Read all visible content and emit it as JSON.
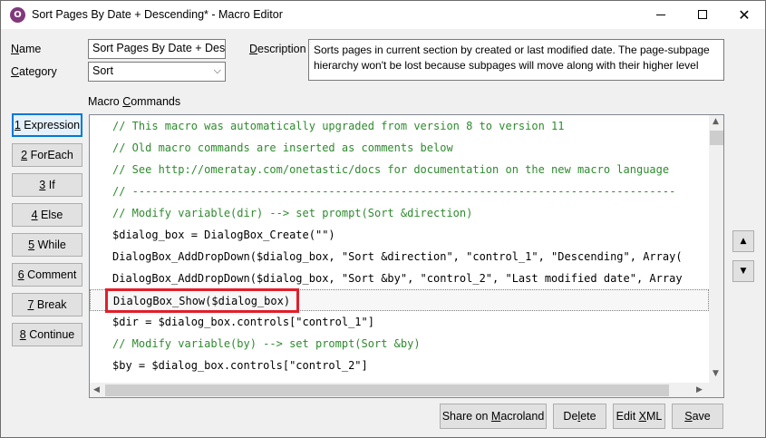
{
  "window": {
    "title": "Sort Pages By Date + Descending* - Macro Editor",
    "icon_name": "onetastic-icon",
    "minimize_icon": "minimize-icon",
    "maximize_icon": "maximize-icon",
    "close_icon": "close-icon"
  },
  "form": {
    "name_label": "Name",
    "name_value": "Sort Pages By Date + Desce",
    "category_label": "Category",
    "category_value": "Sort",
    "description_label": "Description",
    "description_value": "Sorts pages in current section by created or last modified date. The page-subpage hierarchy won't be lost because subpages will move along with their higher level"
  },
  "commands": {
    "section_label": "Macro Commands",
    "buttons": [
      {
        "key": "1",
        "label": "Expression"
      },
      {
        "key": "2",
        "label": "ForEach"
      },
      {
        "key": "3",
        "label": "If"
      },
      {
        "key": "4",
        "label": "Else"
      },
      {
        "key": "5",
        "label": "While"
      },
      {
        "key": "6",
        "label": "Comment"
      },
      {
        "key": "7",
        "label": "Break"
      },
      {
        "key": "8",
        "label": "Continue"
      }
    ]
  },
  "editor": {
    "lines": [
      {
        "text": "// This macro was automatically upgraded from version 8 to version 11",
        "type": "comment"
      },
      {
        "text": "// Old macro commands are inserted as comments below",
        "type": "comment"
      },
      {
        "text": "// See http://omeratay.com/onetastic/docs for documentation on the new macro language",
        "type": "comment"
      },
      {
        "text": "// -----------------------------------------------------------------------------------",
        "type": "comment"
      },
      {
        "text": "// Modify variable(dir) --> set prompt(Sort &direction)",
        "type": "comment"
      },
      {
        "text": "$dialog_box = DialogBox_Create(\"\")",
        "type": "code"
      },
      {
        "text": "DialogBox_AddDropDown($dialog_box, \"Sort &direction\", \"control_1\", \"Descending\", Array(",
        "type": "code"
      },
      {
        "text": "DialogBox_AddDropDown($dialog_box, \"Sort &by\", \"control_2\", \"Last modified date\", Array",
        "type": "code"
      },
      {
        "text": "DialogBox_Show($dialog_box)",
        "type": "code",
        "selected": true
      },
      {
        "text": "$dir = $dialog_box.controls[\"control_1\"]",
        "type": "code"
      },
      {
        "text": "// Modify variable(by) --> set prompt(Sort &by)",
        "type": "comment"
      },
      {
        "text": "$by = $dialog_box.controls[\"control_2\"]",
        "type": "code"
      }
    ]
  },
  "footer": {
    "share_label": "Share on Macroland",
    "delete_label": "Delete",
    "editxml_label": "Edit XML",
    "save_label": "Save"
  },
  "colors": {
    "comment": "#2e8b2e",
    "highlight": "#e21e2a",
    "focus": "#0078d7"
  }
}
